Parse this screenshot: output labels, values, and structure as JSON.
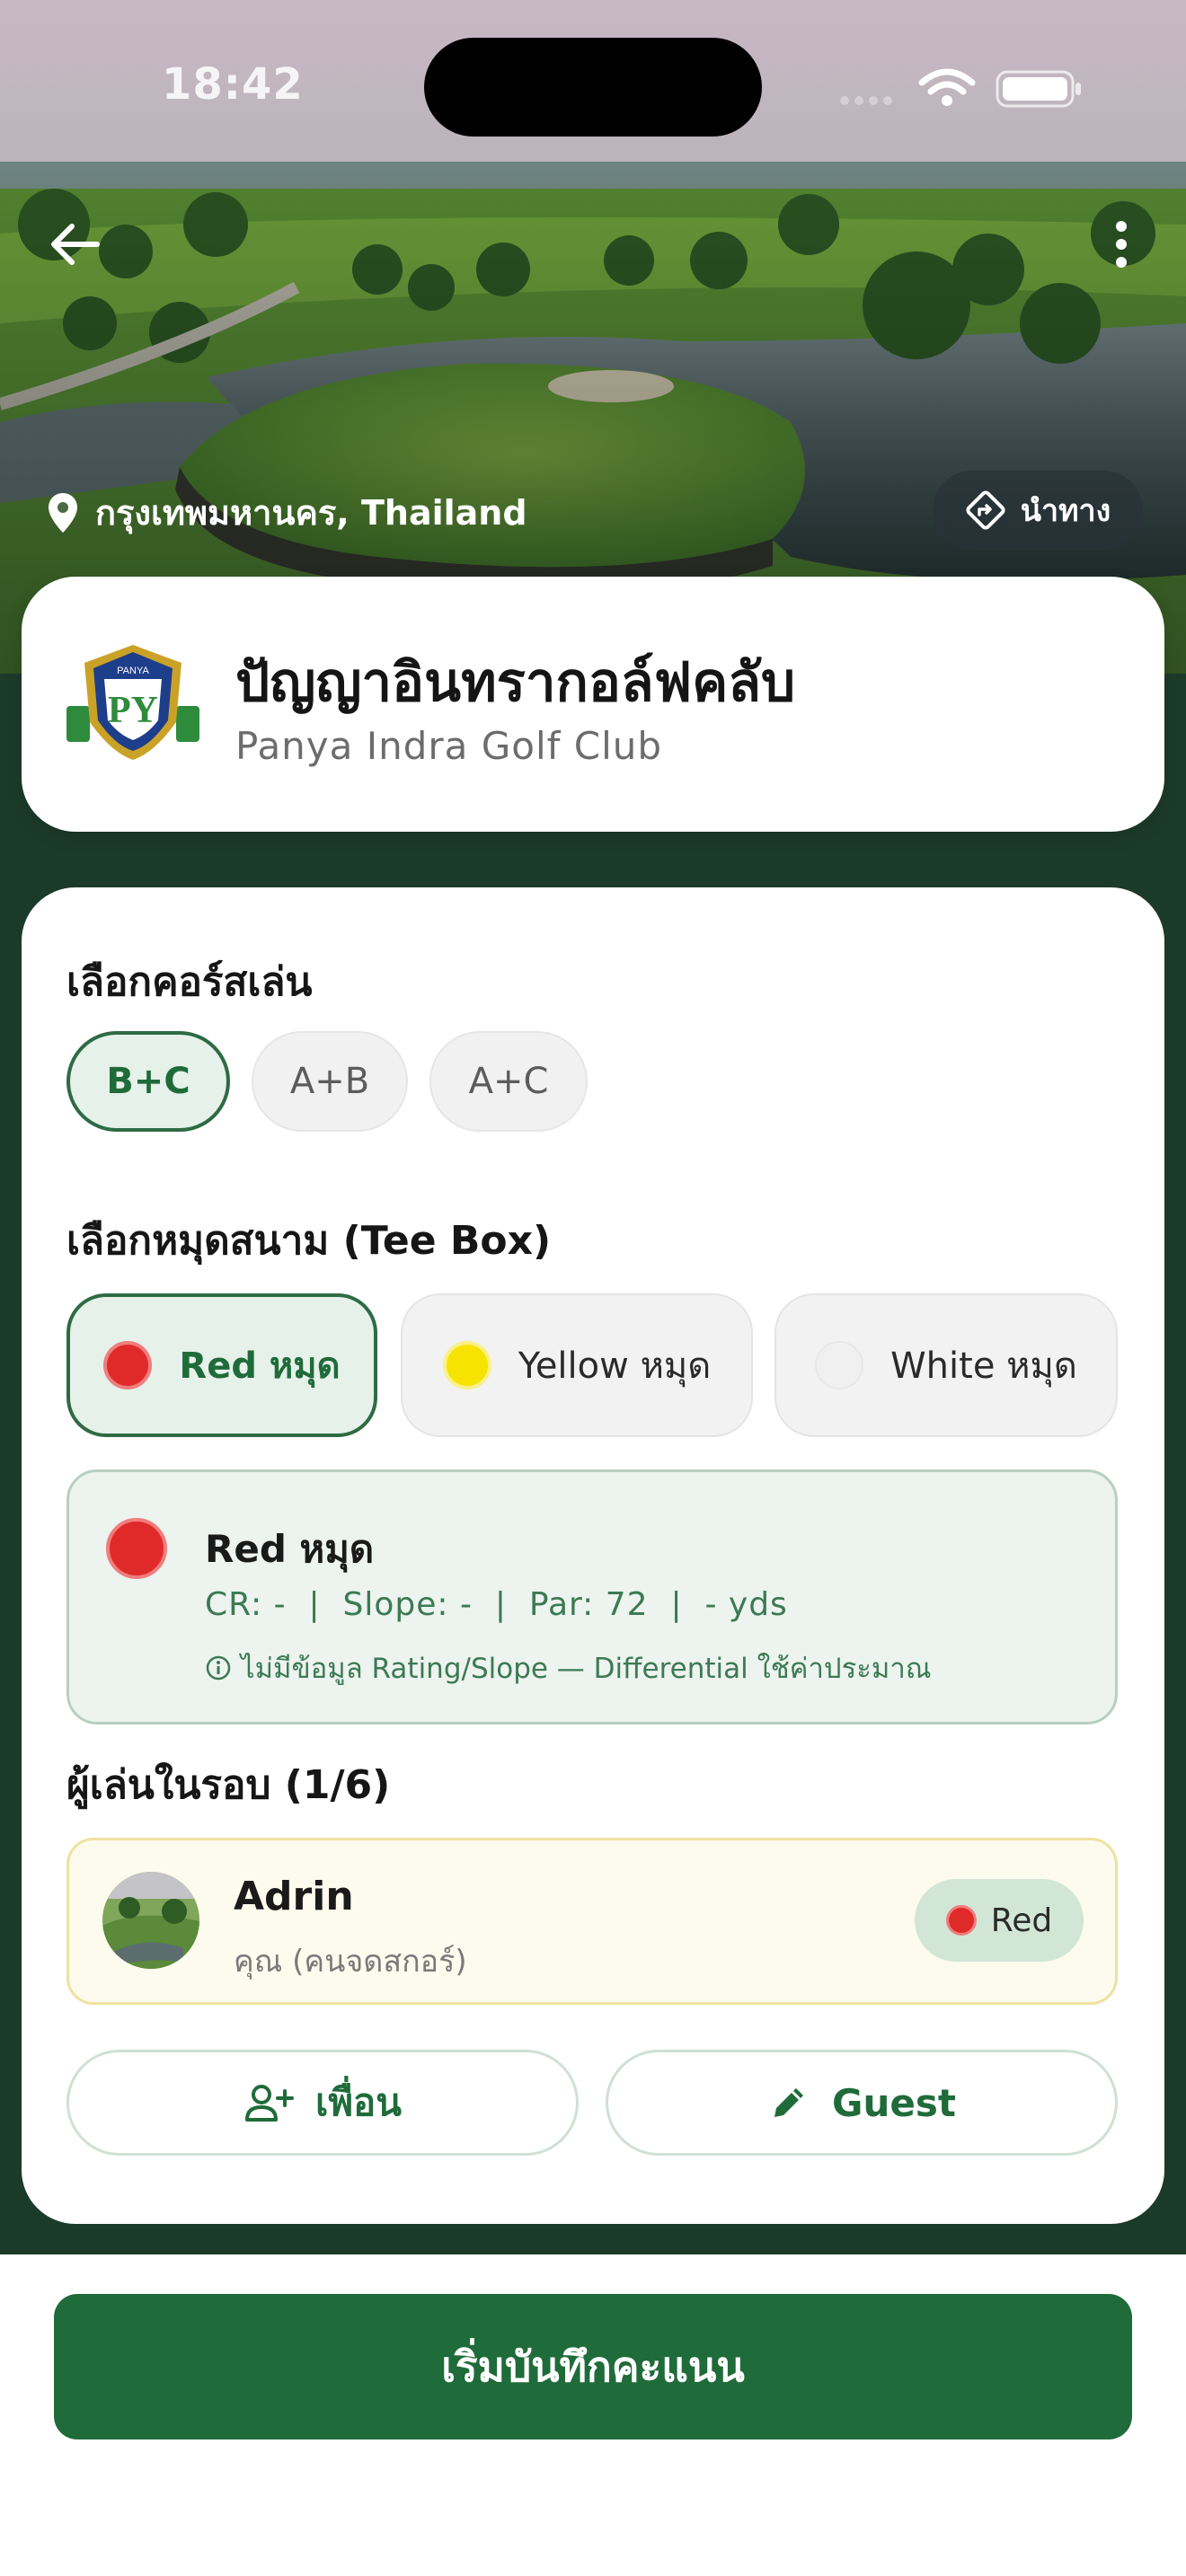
{
  "status_bar": {
    "time": "18:42"
  },
  "hero": {
    "location": "กรุงเทพมหานคร, Thailand",
    "navigate_label": "นำทาง"
  },
  "club": {
    "name_th": "ปัญญาอินทรากอล์ฟคลับ",
    "name_en": "Panya Indra Golf Club",
    "logo_letters": "PANYA"
  },
  "course": {
    "label": "เลือกคอร์สเล่น",
    "options": [
      "B+C",
      "A+B",
      "A+C"
    ],
    "selected": "B+C"
  },
  "tee_box": {
    "label": "เลือกหมุดสนาม (Tee Box)",
    "options": [
      {
        "label": "Red หมุด",
        "color": "#e02a2a"
      },
      {
        "label": "Yellow หมุด",
        "color": "#f6e400"
      },
      {
        "label": "White หมุด",
        "color": "#f0f0f0"
      }
    ],
    "selected": "Red หมุด"
  },
  "tee_info": {
    "title": "Red หมุด",
    "stats": "CR: -  |  Slope: -  |  Par: 72  |  - yds",
    "note": "ไม่มีข้อมูล Rating/Slope — Differential ใช้ค่าประมาณ",
    "note_icon": "info-icon"
  },
  "players": {
    "label": "ผู้เล่นในรอบ (1/6)",
    "items": [
      {
        "name": "Adrin",
        "role": "คุณ (คนจดสกอร์)",
        "tee": "Red",
        "tee_color": "#e02a2a"
      }
    ]
  },
  "actions": {
    "add_friend": "เพื่อน",
    "add_guest": "Guest"
  },
  "cta": {
    "start_label": "เริ่มบันทึกคะแนน"
  },
  "colors": {
    "brand_green": "#1f6b3a",
    "dark_green": "#1c3a2a",
    "selected_bg": "#e6f1ea"
  }
}
